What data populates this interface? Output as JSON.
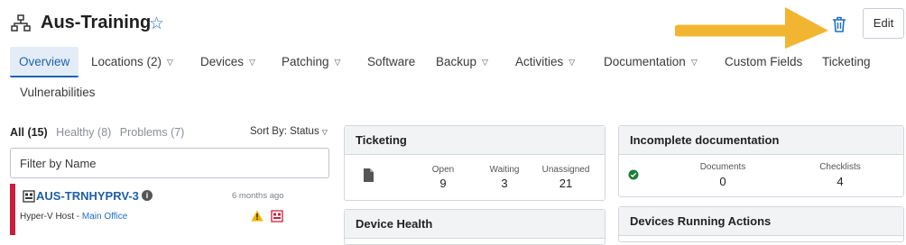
{
  "header": {
    "title": "Aus-Training",
    "edit_label": "Edit",
    "org_icon": "org-chart-icon",
    "star_icon": "star-outline-icon",
    "delete_icon": "trash-icon",
    "arrow_color": "#f2b531"
  },
  "tabs": [
    {
      "label": "Overview",
      "active": true
    },
    {
      "label": "Locations (2)",
      "dropdown": true
    },
    {
      "label": "Devices",
      "dropdown": true
    },
    {
      "label": "Patching",
      "dropdown": true
    },
    {
      "label": "Software"
    },
    {
      "label": "Backup",
      "dropdown": true
    },
    {
      "label": "Activities",
      "dropdown": true
    },
    {
      "label": "Documentation",
      "dropdown": true
    },
    {
      "label": "Custom Fields"
    },
    {
      "label": "Ticketing"
    },
    {
      "label": "Vulnerabilities"
    }
  ],
  "device_list": {
    "filters": [
      "All (15)",
      "Healthy (8)",
      "Problems (7)"
    ],
    "sort_label": "Sort By: Status",
    "filter_placeholder": "Filter by Name",
    "devices": [
      {
        "name": "AUS-TRNHYPRV-3",
        "time": "6 months ago",
        "type": "Hyper-V Host - ",
        "site": "Main Office",
        "status_color": "#c8203c"
      }
    ]
  },
  "ticketing": {
    "title": "Ticketing",
    "stats": [
      {
        "label": "Open",
        "value": "9"
      },
      {
        "label": "Waiting",
        "value": "3"
      },
      {
        "label": "Unassigned",
        "value": "21"
      }
    ]
  },
  "incomplete_docs": {
    "title": "Incomplete documentation",
    "stats": [
      {
        "label": "Documents",
        "value": "0"
      },
      {
        "label": "Checklists",
        "value": "4"
      }
    ]
  },
  "device_health": {
    "title": "Device Health"
  },
  "devices_running": {
    "title": "Devices Running Actions"
  }
}
